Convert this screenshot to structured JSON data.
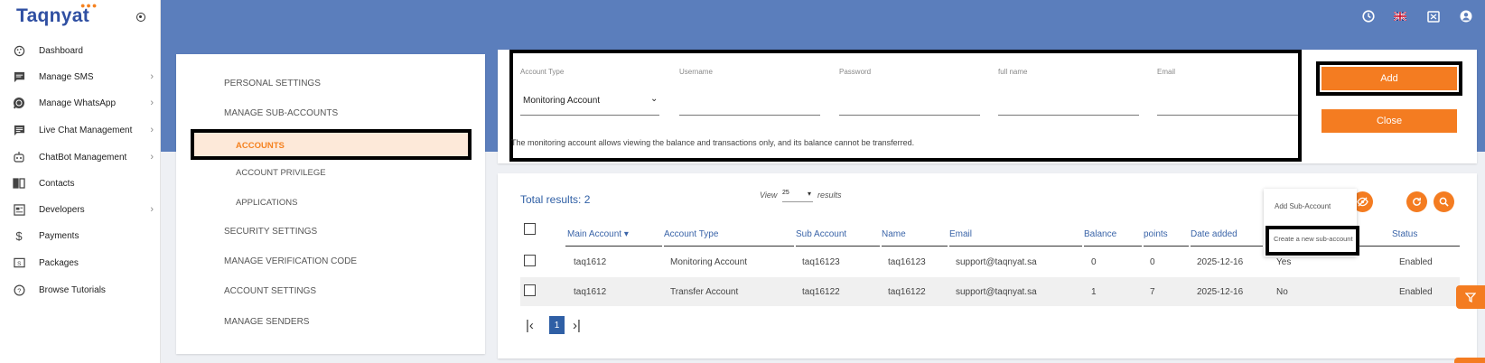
{
  "app": {
    "logo": "Taqnyat"
  },
  "sidebar": {
    "items": [
      {
        "label": "Dashboard",
        "icon": "dashboard-icon",
        "has_children": false
      },
      {
        "label": "Manage SMS",
        "icon": "sms-icon",
        "has_children": true
      },
      {
        "label": "Manage WhatsApp",
        "icon": "whatsapp-icon",
        "has_children": true
      },
      {
        "label": "Live Chat Management",
        "icon": "chat-icon",
        "has_children": true
      },
      {
        "label": "ChatBot Management",
        "icon": "robot-icon",
        "has_children": true
      },
      {
        "label": "Contacts",
        "icon": "contacts-icon",
        "has_children": false
      },
      {
        "label": "Developers",
        "icon": "developers-icon",
        "has_children": true
      },
      {
        "label": "Payments",
        "icon": "dollar-icon",
        "has_children": false
      },
      {
        "label": "Packages",
        "icon": "packages-icon",
        "has_children": false
      },
      {
        "label": "Browse Tutorials",
        "icon": "help-icon",
        "has_children": false
      }
    ]
  },
  "topbar": {
    "icons": [
      "clock-icon",
      "uk-flag-icon",
      "fullscreen-icon",
      "user-icon"
    ]
  },
  "settings_menu": {
    "personal": "PERSONAL SETTINGS",
    "manage_sub_accounts": "MANAGE SUB-ACCOUNTS",
    "accounts": "ACCOUNTS",
    "account_privilege": "ACCOUNT PRIVILEGE",
    "applications": "APPLICATIONS",
    "security": "SECURITY SETTINGS",
    "verification": "MANAGE VERIFICATION CODE",
    "account_settings": "ACCOUNT SETTINGS",
    "senders": "MANAGE SENDERS"
  },
  "form": {
    "account_type_label": "Account Type",
    "account_type_value": "Monitoring Account",
    "username_label": "Username",
    "password_label": "Password",
    "fullname_label": "full name",
    "email_label": "Email",
    "note": "The monitoring account allows viewing the balance and transactions only, and its balance cannot be transferred.",
    "add_label": "Add",
    "close_label": "Close"
  },
  "table": {
    "total_label": "Total results: 2",
    "view_label": "View",
    "view_value": "25",
    "results_label": "results",
    "columns": [
      "Main Account ▾",
      "Account Type",
      "Sub Account",
      "Name",
      "Email",
      "Balance",
      "points",
      "Date added",
      "Status"
    ],
    "rows": [
      {
        "main": "taq1612",
        "type": "Monitoring Account",
        "sub": "taq16123",
        "name": "taq16123",
        "email": "support@taqnyat.sa",
        "balance": "0",
        "points": "0",
        "date": "2025-12-16",
        "flag": "Yes",
        "status": "Enabled"
      },
      {
        "main": "taq1612",
        "type": "Transfer Account",
        "sub": "taq16122",
        "name": "taq16122",
        "email": "support@taqnyat.sa",
        "balance": "1",
        "points": "7",
        "date": "2025-12-16",
        "flag": "No",
        "status": "Enabled"
      }
    ],
    "pagination": {
      "first": "|‹",
      "current": "1",
      "last": "›|"
    }
  },
  "dropdown": {
    "add_sub_account": "Add Sub-Account",
    "create_new": "Create a new sub-account"
  },
  "colors": {
    "accent": "#f47c21",
    "header": "#5b7ebc",
    "link": "#2f5fa5"
  }
}
